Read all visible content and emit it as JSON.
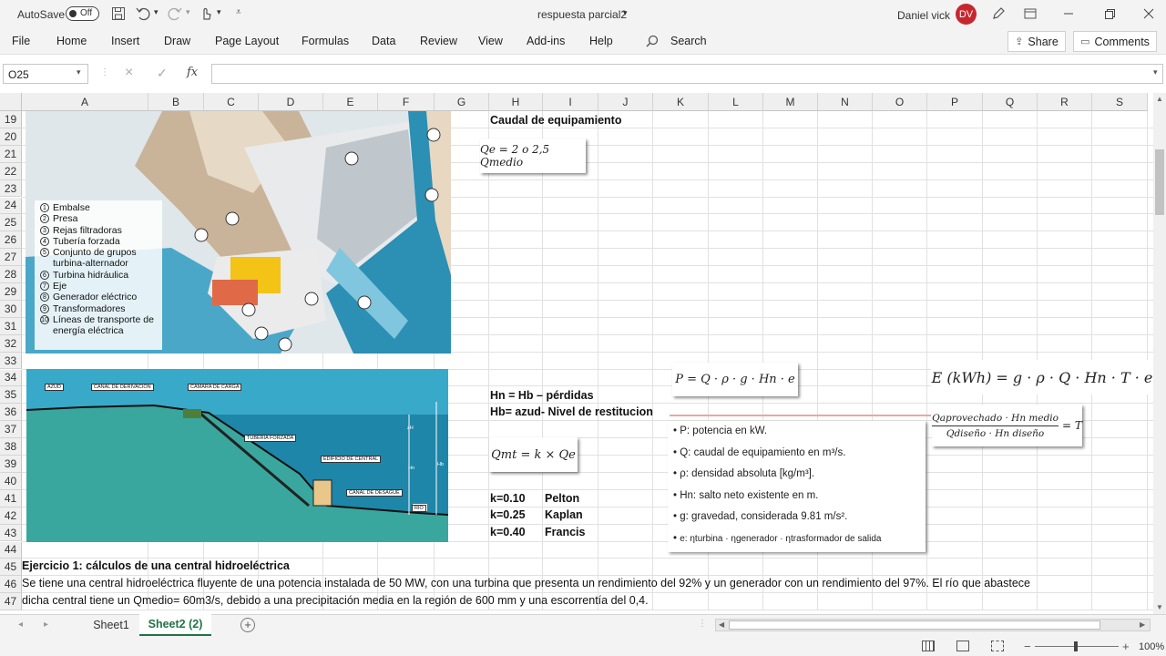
{
  "titlebar": {
    "autosave_label": "AutoSave",
    "autosave_state": "Off",
    "doc_title": "respuesta parcial2",
    "user_name": "Daniel vick",
    "user_initials": "DV"
  },
  "menu": {
    "items": [
      "File",
      "Home",
      "Insert",
      "Draw",
      "Page Layout",
      "Formulas",
      "Data",
      "Review",
      "View",
      "Add-ins",
      "Help"
    ],
    "search": "Search",
    "share": "Share",
    "comments": "Comments"
  },
  "formula_bar": {
    "name_box": "O25",
    "fx": "fx",
    "value": ""
  },
  "columns": [
    "A",
    "B",
    "C",
    "D",
    "E",
    "F",
    "G",
    "H",
    "I",
    "J",
    "K",
    "L",
    "M",
    "N",
    "O",
    "P",
    "Q",
    "R",
    "S"
  ],
  "rows": [
    "19",
    "20",
    "21",
    "22",
    "23",
    "24",
    "25",
    "26",
    "27",
    "28",
    "29",
    "30",
    "31",
    "32",
    "33",
    "34",
    "35",
    "36",
    "37",
    "38",
    "39",
    "40",
    "41",
    "42",
    "43",
    "44",
    "45",
    "46",
    "47"
  ],
  "cells": {
    "caudal": "Caudal de equipamiento",
    "hn": "Hn = Hb – pérdidas",
    "hb": "Hb= azud-  Nivel de restitucion",
    "k1": "k=0.10",
    "t1": "Pelton",
    "k2": "k=0.25",
    "t2": "Kaplan",
    "k3": "k=0.40",
    "t3": "Francis",
    "ej_title": "Ejercicio 1: cálculos de una central hidroeléctrica",
    "ej_l1": "Se tiene una central hidroeléctrica fluyente de una potencia instalada de 50 MW, con una turbina que presenta un rendimiento del 92% y un generador con un rendimiento del 97%. El río que abastece",
    "ej_l2": "dicha central tiene un Qmedio= 60m3/s, debido a una precipitación media en la región de 600 mm y una escorrentía del 0,4."
  },
  "equations": {
    "qe": "Qe = 2 o 2,5 Qmedio",
    "qmt": "Qmt = k × Qe",
    "p": "P = Q · ρ · g · Hn · e",
    "e": "E (kWh) = g · ρ · Q · Hn · T · e",
    "t_num": "Qaprovechado · Hn medio",
    "t_den": "Qdiseño · Hn diseño",
    "t_res": "= T"
  },
  "legend_list": [
    "P: potencia en kW.",
    "Q: caudal de equipamiento en m³/s.",
    "ρ: densidad absoluta [kg/m³].",
    "Hn: salto neto existente en m.",
    "g: gravedad, considerada 9.81 m/s².",
    "e: ηturbina · ηgenerador · ηtrasformador de salida"
  ],
  "dam_legend": [
    "Embalse",
    "Presa",
    "Rejas filtradoras",
    "Tubería forzada",
    "Conjunto de grupos turbina-alternador",
    "Turbina hidráulica",
    "Eje",
    "Generador eléctrico",
    "Transformadores",
    "Líneas de transporte de energía eléctrica"
  ],
  "profile_labels": {
    "azud": "AZUD",
    "canal_der": "CANAL DE DERIVACION",
    "camara": "CAMARA DE CARGA",
    "tuberia": "TUBERIA FORZADA",
    "edificio": "EDIFICIO DE CENTRAL",
    "canal_des": "CANAL DE DESAGUE",
    "rio": "RIO",
    "h1": "zH",
    "h2": "Hn",
    "h3": "Hb"
  },
  "sheets": {
    "tab1": "Sheet1",
    "tab2": "Sheet2 (2)"
  },
  "status": {
    "zoom": "100%"
  }
}
